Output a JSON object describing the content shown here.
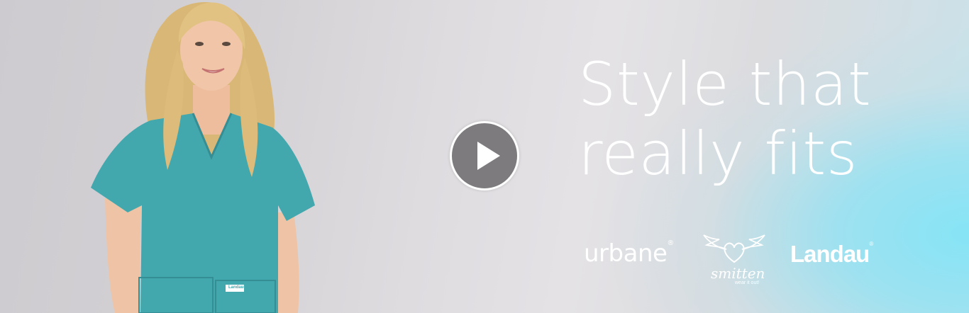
{
  "banner": {
    "headline_line1": "Style that",
    "headline_line2": "really fits",
    "play_button_icon": "play-icon"
  },
  "brands": {
    "urbane": "urbane",
    "urbane_mark": "®",
    "smitten": "smitten",
    "smitten_tagline": "wear it out!",
    "landau": "Landau",
    "landau_mark": "®"
  },
  "model": {
    "scrub_label": "Landau"
  },
  "colors": {
    "scrub_teal": "#43a8ae",
    "accent_cyan": "#8be3f5",
    "headline_white": "#ffffff",
    "play_gray": "#7d7b7e"
  }
}
